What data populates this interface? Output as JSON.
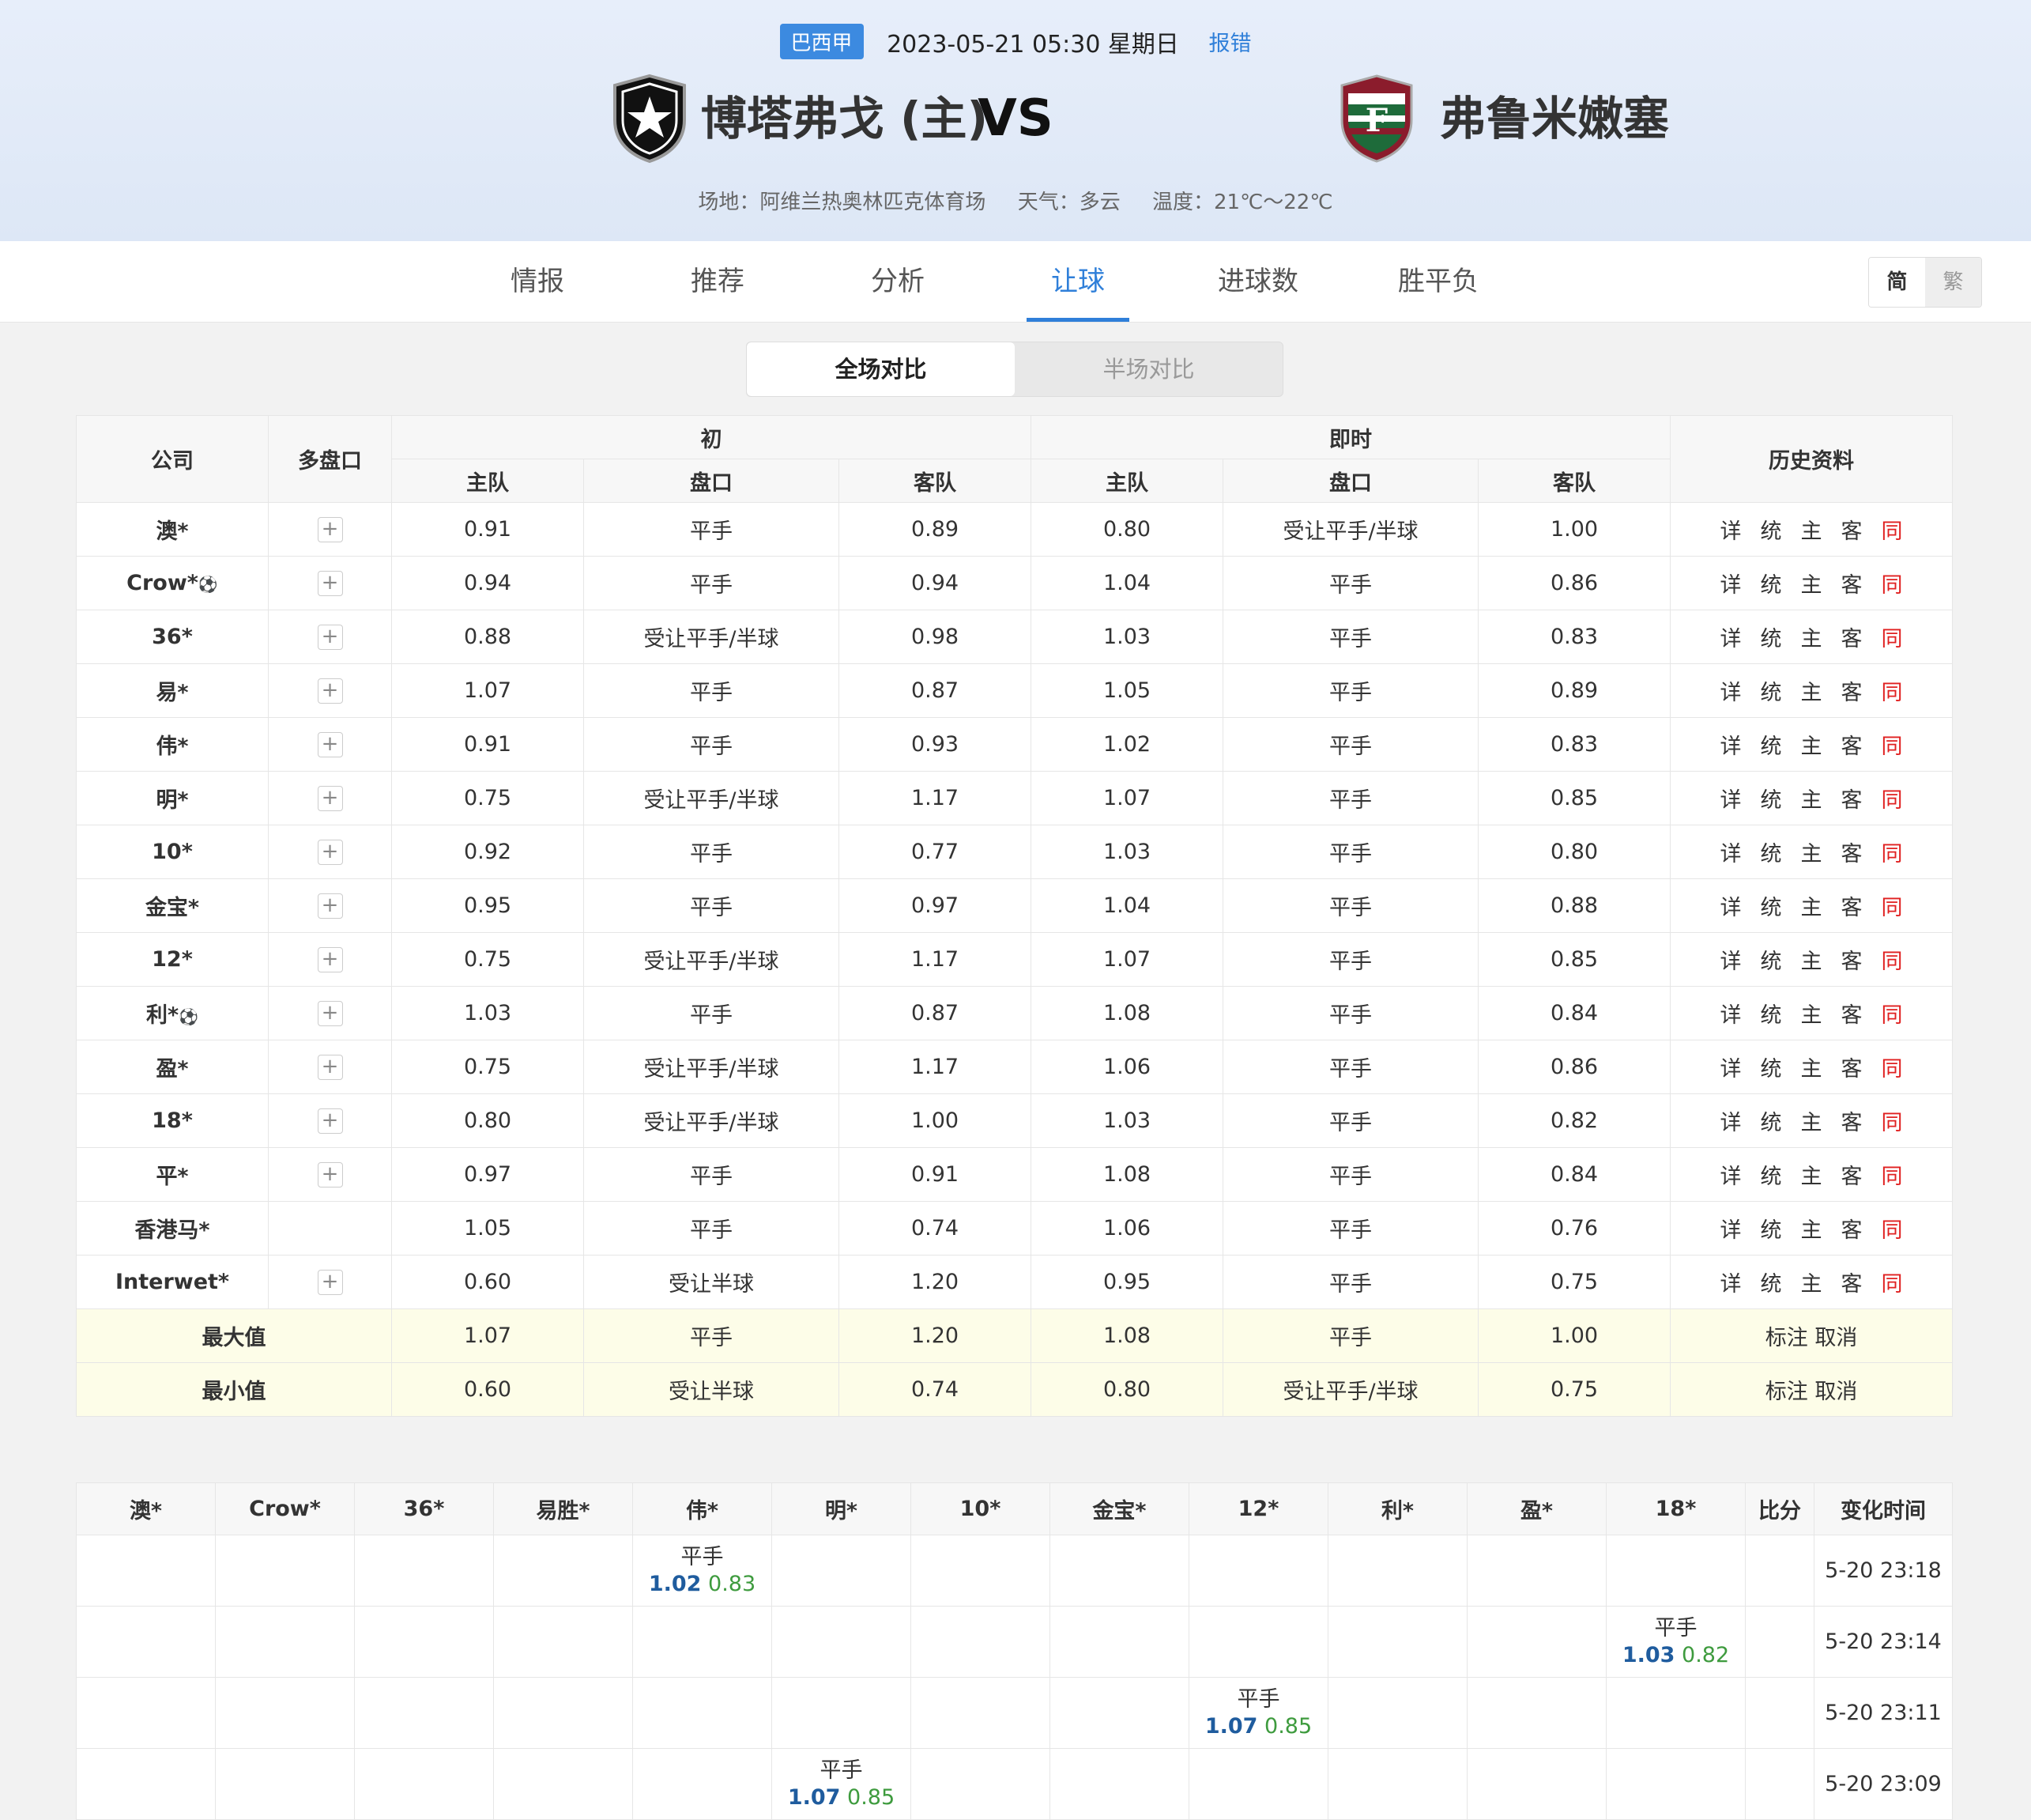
{
  "header": {
    "league": "巴西甲",
    "datetime": "2023-05-21 05:30 星期日",
    "report": "报错",
    "home_team": "博塔弗戈 (主)",
    "vs": "VS",
    "away_team": "弗鲁米嫩塞",
    "venue": "场地：阿维兰热奥林匹克体育场",
    "weather": "天气：多云",
    "temperature": "温度：21℃～22℃"
  },
  "nav": {
    "tabs": [
      "情报",
      "推荐",
      "分析",
      "让球",
      "进球数",
      "胜平负"
    ],
    "active": "让球",
    "lang_simplified": "简",
    "lang_traditional": "繁"
  },
  "segment": {
    "full": "全场对比",
    "half": "半场对比"
  },
  "odds_table": {
    "headers": {
      "company": "公司",
      "multi": "多盘口",
      "initial": "初",
      "live": "即时",
      "history": "历史资料",
      "home": "主队",
      "line": "盘口",
      "away": "客队"
    },
    "history_links": [
      "详",
      "统",
      "主",
      "客",
      "同"
    ],
    "rows": [
      {
        "company": "澳*",
        "plus": true,
        "i_home": "0.91",
        "i_line": "平手",
        "i_away": "0.89",
        "l_home": "0.80",
        "l_line": "受让平手/半球",
        "l_away": "1.00"
      },
      {
        "company": "Crow*",
        "ball": true,
        "plus": true,
        "i_home": "0.94",
        "i_line": "平手",
        "i_away": "0.94",
        "l_home": "1.04",
        "l_line": "平手",
        "l_away": "0.86"
      },
      {
        "company": "36*",
        "plus": true,
        "i_home": "0.88",
        "i_line": "受让平手/半球",
        "i_away": "0.98",
        "l_home": "1.03",
        "l_line": "平手",
        "l_away": "0.83"
      },
      {
        "company": "易*",
        "plus": true,
        "i_home": "1.07",
        "i_line": "平手",
        "i_away": "0.87",
        "l_home": "1.05",
        "l_line": "平手",
        "l_away": "0.89"
      },
      {
        "company": "伟*",
        "plus": true,
        "i_home": "0.91",
        "i_line": "平手",
        "i_away": "0.93",
        "l_home": "1.02",
        "l_line": "平手",
        "l_away": "0.83"
      },
      {
        "company": "明*",
        "plus": true,
        "i_home": "0.75",
        "i_line": "受让平手/半球",
        "i_away": "1.17",
        "l_home": "1.07",
        "l_line": "平手",
        "l_away": "0.85"
      },
      {
        "company": "10*",
        "plus": true,
        "i_home": "0.92",
        "i_line": "平手",
        "i_away": "0.77",
        "l_home": "1.03",
        "l_line": "平手",
        "l_away": "0.80"
      },
      {
        "company": "金宝*",
        "plus": true,
        "i_home": "0.95",
        "i_line": "平手",
        "i_away": "0.97",
        "l_home": "1.04",
        "l_line": "平手",
        "l_away": "0.88"
      },
      {
        "company": "12*",
        "plus": true,
        "i_home": "0.75",
        "i_line": "受让平手/半球",
        "i_away": "1.17",
        "l_home": "1.07",
        "l_line": "平手",
        "l_away": "0.85"
      },
      {
        "company": "利*",
        "ball": true,
        "plus": true,
        "i_home": "1.03",
        "i_line": "平手",
        "i_away": "0.87",
        "l_home": "1.08",
        "l_line": "平手",
        "l_away": "0.84"
      },
      {
        "company": "盈*",
        "plus": true,
        "i_home": "0.75",
        "i_line": "受让平手/半球",
        "i_away": "1.17",
        "l_home": "1.06",
        "l_line": "平手",
        "l_away": "0.86"
      },
      {
        "company": "18*",
        "plus": true,
        "i_home": "0.80",
        "i_line": "受让平手/半球",
        "i_away": "1.00",
        "l_home": "1.03",
        "l_line": "平手",
        "l_away": "0.82"
      },
      {
        "company": "平*",
        "plus": true,
        "i_home": "0.97",
        "i_line": "平手",
        "i_away": "0.91",
        "l_home": "1.08",
        "l_line": "平手",
        "l_away": "0.84"
      },
      {
        "company": "香港马*",
        "plus": false,
        "i_home": "1.05",
        "i_line": "平手",
        "i_away": "0.74",
        "l_home": "1.06",
        "l_line": "平手",
        "l_away": "0.76"
      },
      {
        "company": "Interwet*",
        "plus": true,
        "i_home": "0.60",
        "i_line": "受让半球",
        "i_away": "1.20",
        "l_home": "0.95",
        "l_line": "平手",
        "l_away": "0.75"
      }
    ],
    "summary": [
      {
        "label": "最大值",
        "i_home": "1.07",
        "i_line": "平手",
        "i_away": "1.20",
        "l_home": "1.08",
        "l_line": "平手",
        "l_away": "1.00",
        "action": "标注 取消"
      },
      {
        "label": "最小值",
        "i_home": "0.60",
        "i_line": "受让半球",
        "i_away": "0.74",
        "l_home": "0.80",
        "l_line": "受让平手/半球",
        "l_away": "0.75",
        "action": "标注 取消"
      }
    ]
  },
  "changes_table": {
    "headers": [
      "澳*",
      "Crow*",
      "36*",
      "易胜*",
      "伟*",
      "明*",
      "10*",
      "金宝*",
      "12*",
      "利*",
      "盈*",
      "18*",
      "比分",
      "变化时间"
    ],
    "rows": [
      {
        "col": 4,
        "line": "平手",
        "home": "1.02",
        "away": "0.83",
        "time": "5-20 23:18"
      },
      {
        "col": 11,
        "line": "平手",
        "home": "1.03",
        "away": "0.82",
        "time": "5-20 23:14"
      },
      {
        "col": 8,
        "line": "平手",
        "home": "1.07",
        "away": "0.85",
        "time": "5-20 23:11"
      },
      {
        "col": 5,
        "line": "平手",
        "home": "1.07",
        "away": "0.85",
        "time": "5-20 23:09"
      }
    ]
  },
  "colors": {
    "accent": "#2f7fd9",
    "league_badge": "#3c8ae0",
    "red_link": "#e02020",
    "odds_blue": "#1f5c9e",
    "odds_green": "#3e9b3e",
    "summary_bg": "#fdfde8"
  },
  "icons": {
    "home_crest": "botafogo-crest-icon",
    "away_crest": "fluminense-crest-icon",
    "plus": "plus-icon",
    "ball": "soccer-ball-icon"
  }
}
